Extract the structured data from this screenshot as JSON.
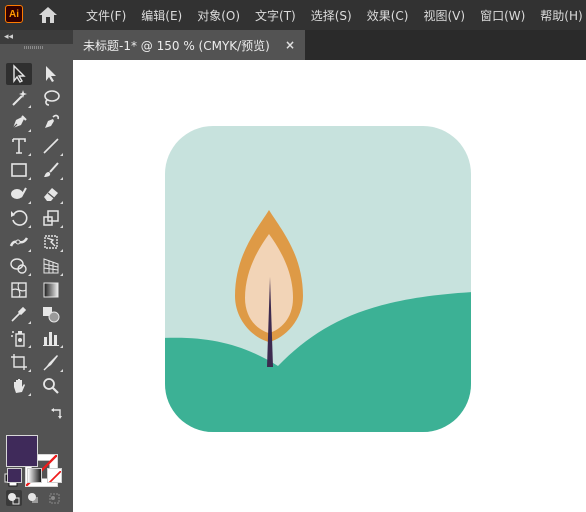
{
  "app": {
    "logo_text": "Ai"
  },
  "menu": [
    "文件(F)",
    "编辑(E)",
    "对象(O)",
    "文字(T)",
    "选择(S)",
    "效果(C)",
    "视图(V)",
    "窗口(W)",
    "帮助(H)"
  ],
  "document_tab": {
    "label": "未标题-1* @ 150 % (CMYK/预览)",
    "close_glyph": "×"
  },
  "toolbar": {
    "collapse_glyph": "◂◂"
  },
  "colors": {
    "fill": "#3f2a5a",
    "artboard_background": "#c7e2dd",
    "hill": "#3cb195",
    "flame_outer": "#de9a46",
    "flame_inner": "#f2d4b7",
    "wick": "#3d2a4f"
  },
  "icons": [
    "selection-tool-icon",
    "direct-selection-tool-icon",
    "magic-wand-icon",
    "lasso-icon",
    "pen-tool-icon",
    "curvature-tool-icon",
    "type-tool-icon",
    "line-tool-icon",
    "rectangle-tool-icon",
    "paintbrush-icon",
    "blob-brush-icon",
    "eraser-icon",
    "rotate-tool-icon",
    "scale-tool-icon",
    "width-tool-icon",
    "free-transform-icon",
    "shape-builder-icon",
    "perspective-grid-icon",
    "mesh-tool-icon",
    "gradient-tool-icon",
    "eyedropper-icon",
    "blend-tool-icon",
    "symbol-sprayer-icon",
    "column-graph-icon",
    "artboard-tool-icon",
    "slice-tool-icon",
    "hand-tool-icon",
    "zoom-tool-icon",
    "swap-colors-icon",
    "default-colors-icon",
    "color-mode-icon",
    "gradient-mode-icon",
    "none-mode-icon",
    "draw-normal-icon",
    "draw-behind-icon",
    "draw-inside-icon",
    "home-icon"
  ]
}
